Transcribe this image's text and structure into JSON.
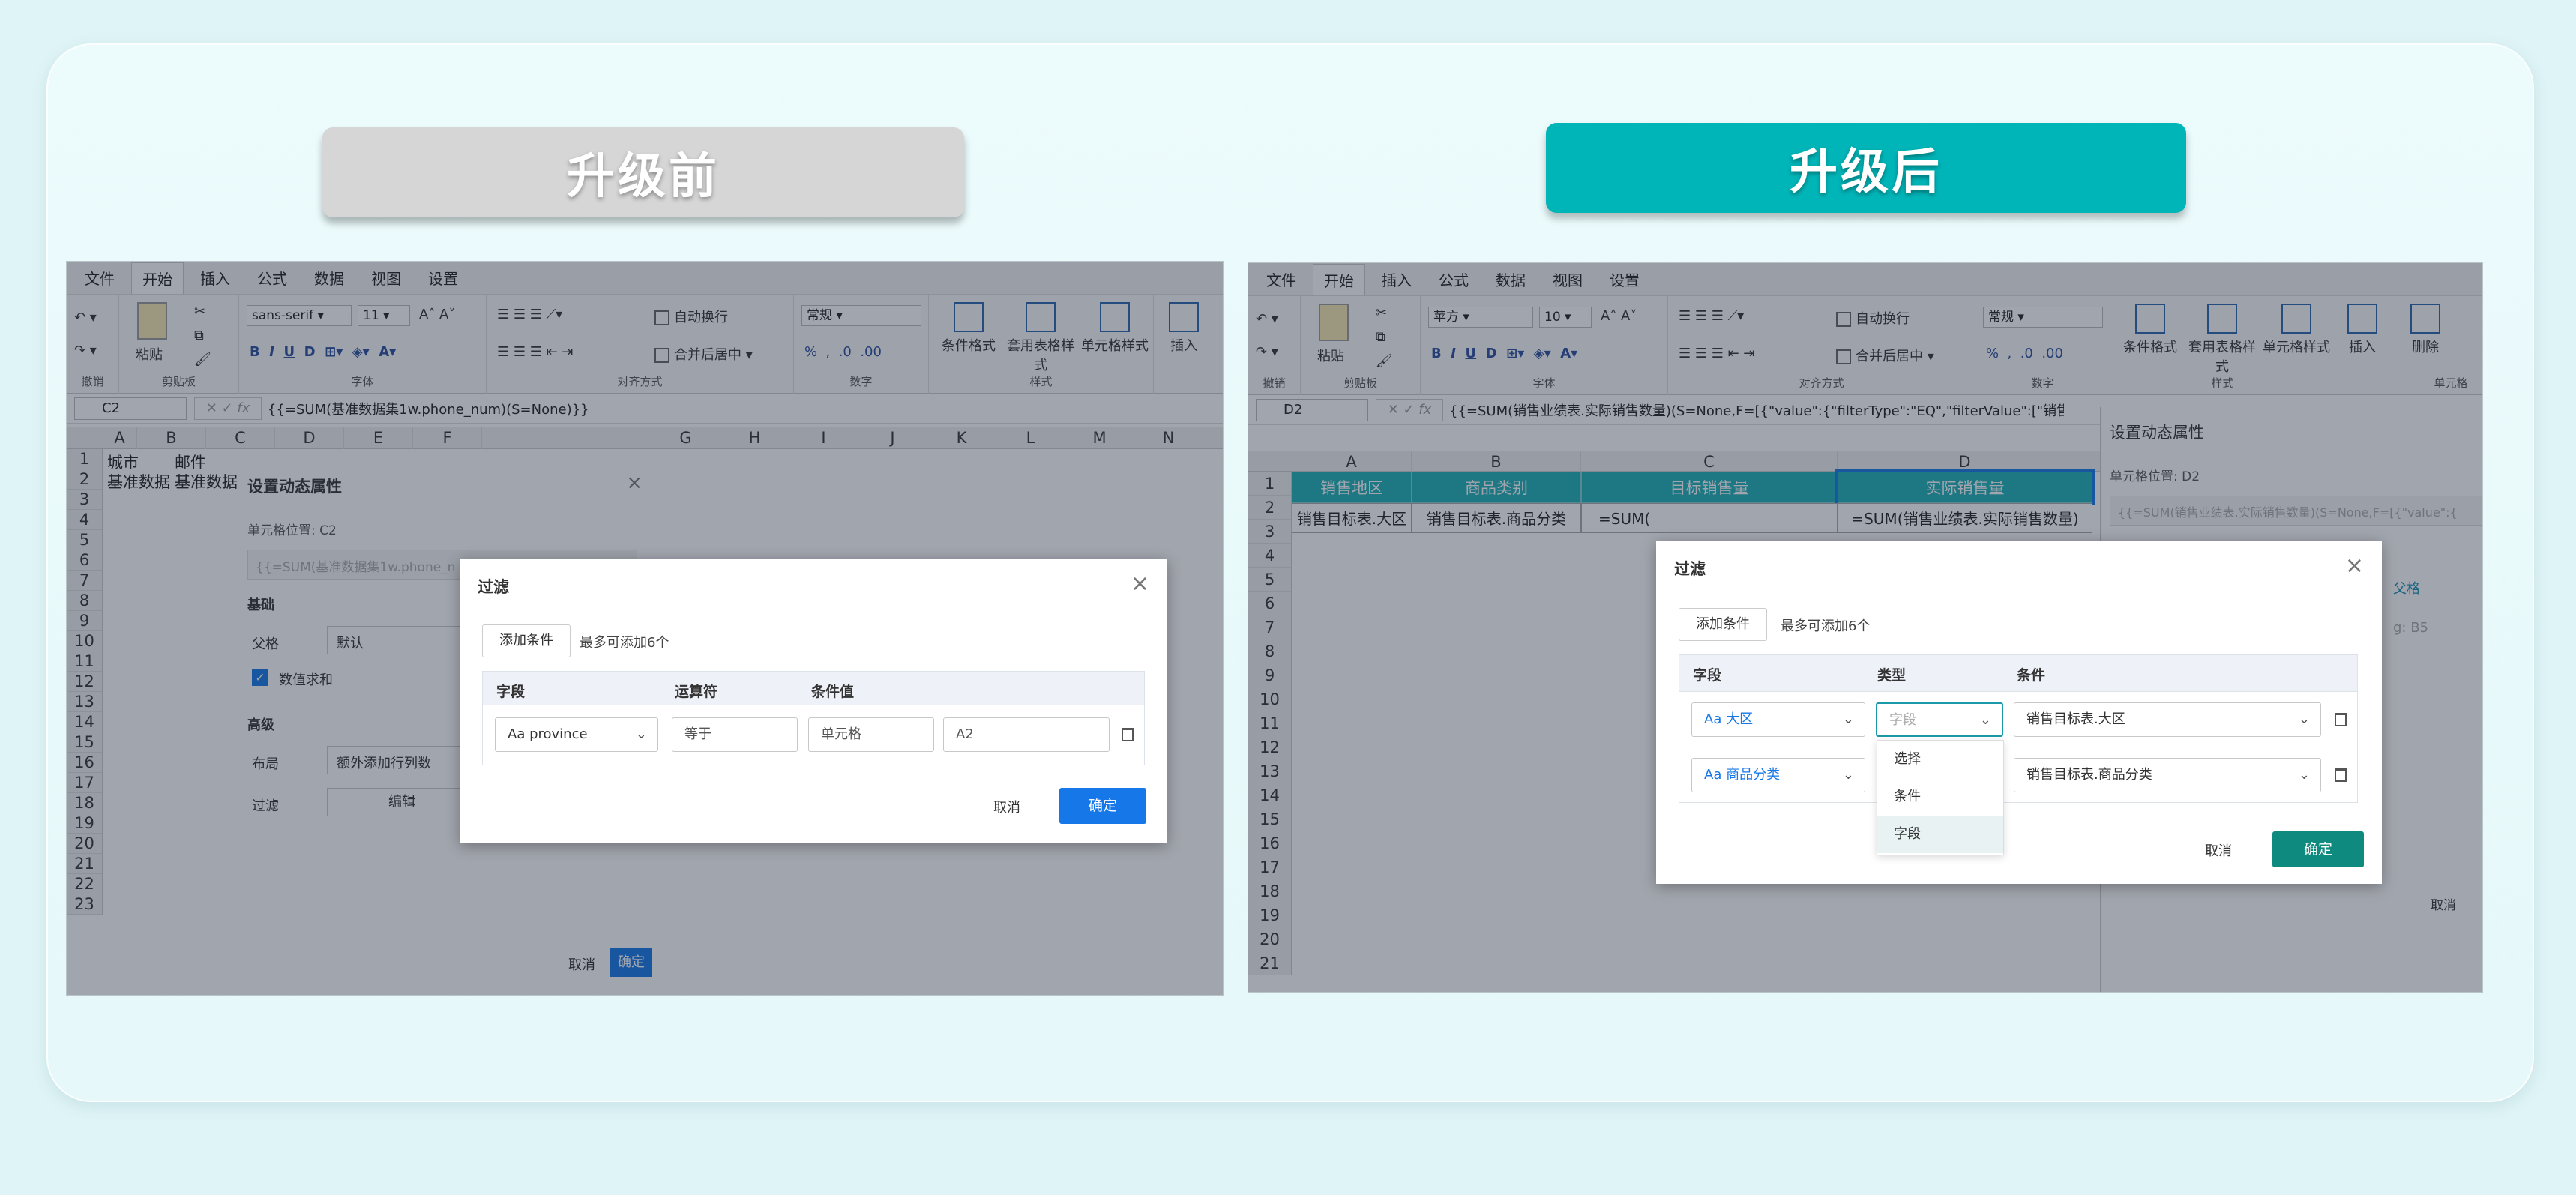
{
  "banners": {
    "before": "升级前",
    "after": "升级后"
  },
  "menu_tabs": [
    "文件",
    "开始",
    "插入",
    "公式",
    "数据",
    "视图",
    "设置"
  ],
  "left": {
    "ribbon": {
      "undo": "撤销",
      "clipboard": "剪贴板",
      "paste": "粘贴",
      "font_name": "sans-serif",
      "font_size": "11",
      "font_group": "字体",
      "wrap": "自动换行",
      "merge": "合并后居中",
      "align_group": "对齐方式",
      "number_format": "常规",
      "number_group": "数字",
      "cond_format": "条件格式",
      "table_style": "套用表格样式",
      "cell_style": "单元格样式",
      "style_group": "样式",
      "insert": "插入"
    },
    "namebox": "C2",
    "formula": "{{=SUM(基准数据集1w.phone_num)(S=None)}}",
    "columns": [
      "A",
      "B",
      "C",
      "D",
      "E",
      "F",
      "G",
      "H",
      "I",
      "J",
      "K",
      "L",
      "M",
      "N"
    ],
    "rows": [
      "1",
      "2",
      "3",
      "4",
      "5",
      "6",
      "7",
      "8",
      "9",
      "10",
      "11",
      "12",
      "13",
      "14",
      "15",
      "16",
      "17",
      "18",
      "19",
      "20",
      "21",
      "22",
      "23"
    ],
    "cells": {
      "a1": "城市",
      "b1": "邮件",
      "a2": "基准数据",
      "b2": "基准数据"
    },
    "panel": {
      "title": "设置动态属性",
      "cell_pos": "单元格位置: C2",
      "formula_preview": "{{=SUM(基准数据集1w.phone_n",
      "basic": "基础",
      "parent_label": "父格",
      "parent_value": "默认",
      "sum_label": "数值求和",
      "advanced": "高级",
      "layout_label": "布局",
      "layout_value": "额外添加行列数",
      "filter_label": "过滤",
      "filter_btn": "编辑",
      "cancel": "取消",
      "ok": "确定"
    },
    "dialog": {
      "title": "过滤",
      "add": "添加条件",
      "hint": "最多可添加6个",
      "col_field": "字段",
      "col_op": "运算符",
      "col_value": "条件值",
      "field": "Aa province",
      "op": "等于",
      "vtype": "单元格",
      "value": "A2",
      "cancel": "取消",
      "ok": "确定"
    },
    "colors": {
      "primary": "#1677e8"
    }
  },
  "right": {
    "ribbon": {
      "undo": "撤销",
      "clipboard": "剪贴板",
      "paste": "粘贴",
      "font_name": "苹方",
      "font_size": "10",
      "font_group": "字体",
      "wrap": "自动换行",
      "merge": "合并后居中",
      "align_group": "对齐方式",
      "number_format": "常规",
      "number_group": "数字",
      "cond_format": "条件格式",
      "table_style": "套用表格样式",
      "cell_style": "单元格样式",
      "style_group": "样式",
      "insert": "插入",
      "delete": "删除",
      "cell_group": "单元格"
    },
    "namebox": "D2",
    "formula": "{{=SUM(销售业绩表.实际销售数量)(S=None,F=[{\"value\":{\"filterType\":\"EQ\",\"filterValue\":[\"销售目标表",
    "columns": [
      "A",
      "B",
      "C",
      "D"
    ],
    "rows": [
      "1",
      "2",
      "3",
      "4",
      "5",
      "6",
      "7",
      "8",
      "9",
      "10",
      "11",
      "12",
      "13",
      "14",
      "15",
      "16",
      "17",
      "18",
      "19",
      "20",
      "21"
    ],
    "headers": [
      "销售地区",
      "商品类别",
      "目标销售量",
      "实际销售量"
    ],
    "row2": [
      "销售目标表.大区",
      "销售目标表.商品分类",
      "=SUM(",
      "=SUM(销售业绩表.实际销售数量)"
    ],
    "panel": {
      "title": "设置动态属性",
      "cell_pos": "单元格位置: D2",
      "formula_preview": "{{=SUM(销售业绩表.实际销售数量)(S=None,F=[{\"value\":{",
      "link1": "父格",
      "ghost": "g: B5",
      "cancel": "取消"
    },
    "dialog": {
      "title": "过滤",
      "add": "添加条件",
      "hint": "最多可添加6个",
      "col_field": "字段",
      "col_type": "类型",
      "col_cond": "条件",
      "row1_field": "Aa 大区",
      "row1_type_placeholder": "字段",
      "row1_cond": "销售目标表.大区",
      "row2_field": "Aa 商品分类",
      "row2_cond": "销售目标表.商品分类",
      "dropdown": [
        "选择",
        "条件",
        "字段"
      ],
      "cancel": "取消",
      "ok": "确定"
    },
    "colors": {
      "primary": "#0e8a7e",
      "header": "#1eb1b8"
    }
  }
}
